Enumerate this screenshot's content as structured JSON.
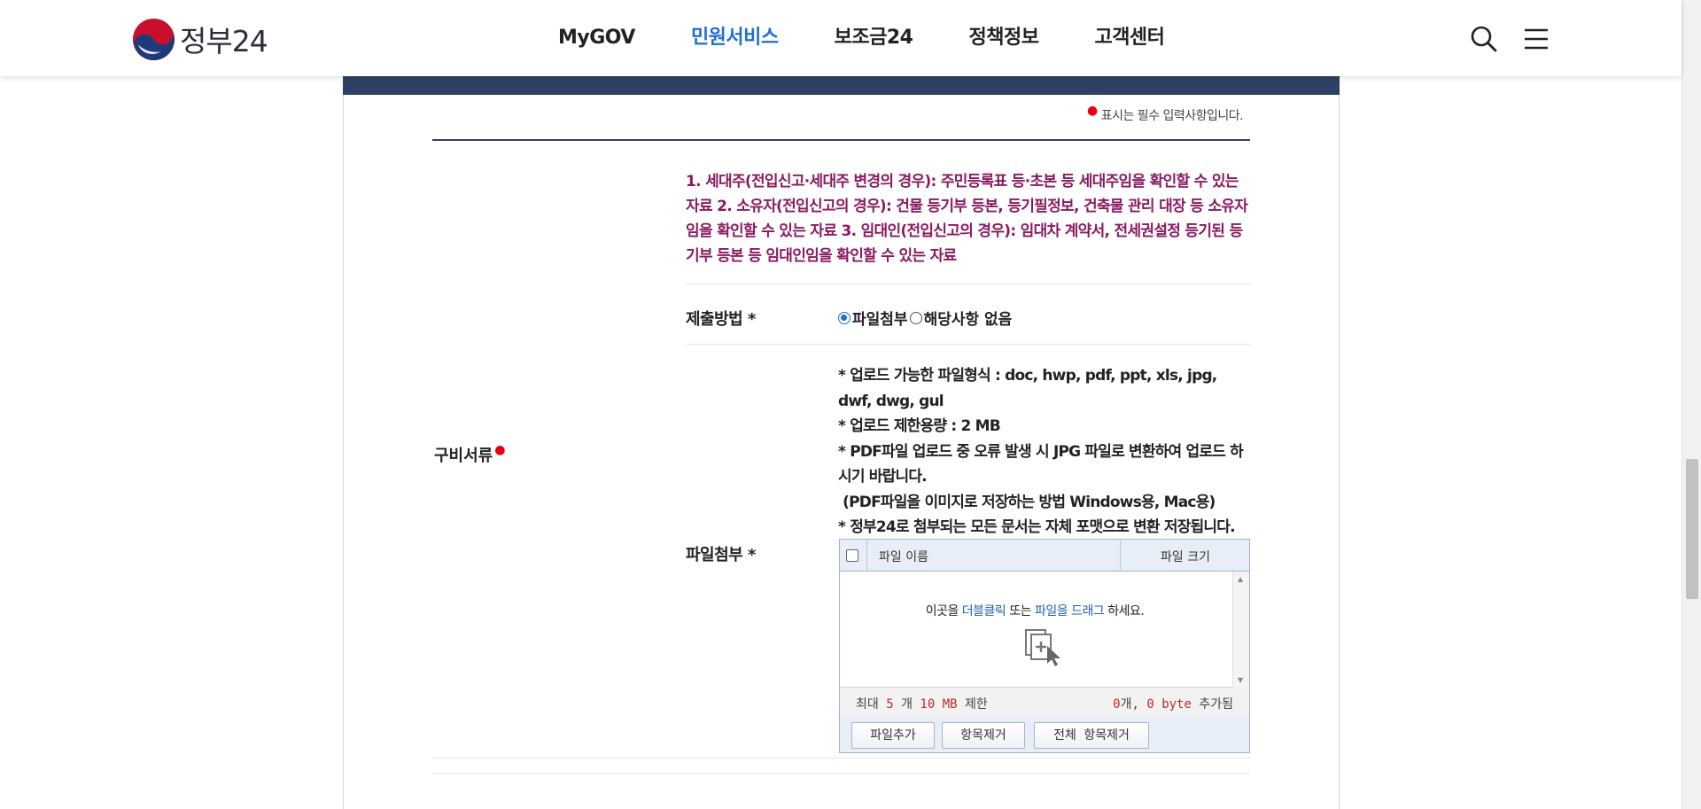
{
  "header": {
    "logo_text": "정부24",
    "nav": [
      "MyGOV",
      "민원서비스",
      "보조금24",
      "정책정보",
      "고객센터"
    ],
    "active_nav_index": 1,
    "active_color": "#1f6fd4"
  },
  "form": {
    "required_note": "표시는 필수 입력사항입니다.",
    "section_label": "구비서류",
    "notice": "1. 세대주(전입신고·세대주 변경의 경우): 주민등록표 등·초본 등 세대주임을 확인할 수 있는 자료 2. 소유자(전입신고의 경우): 건물 등기부 등본, 등기필정보, 건축물 관리 대장 등 소유자임을 확인할 수 있는 자료 3. 임대인(전입신고의 경우): 임대차 계약서, 전세권설정 등기된 등기부 등본 등 임대인임을 확인할 수 있는 자료",
    "submit_method_label": "제출방법 *",
    "submit_options": [
      "파일첨부",
      "해당사항 없음"
    ],
    "submit_selected_index": 0,
    "file_label": "파일첨부 *",
    "guide_lines": [
      "* 업로드 가능한 파일형식 : doc, hwp, pdf, ppt, xls, jpg, dwf, dwg, gul",
      "* 업로드 제한용량 : 2 MB",
      "* PDF파일 업로드 중 오류 발생 시 JPG 파일로 변환하여 업로드 하시기 바랍니다.",
      " (PDF파일을 이미지로 저장하는 방법 Windows용, Mac용)",
      "* 정부24로 첨부되는 모든 문서는 자체 포맷으로 변환 저장됩니다."
    ]
  },
  "uploader": {
    "col_name": "파일 이름",
    "col_size": "파일 크기",
    "hint_prefix": "이곳을",
    "hint_link1": "더블클릭",
    "hint_mid": "또는",
    "hint_link2": "파일을 드래그",
    "hint_suffix": "하세요.",
    "limit_prefix": "최대",
    "limit_count": "5",
    "limit_unit": "개",
    "limit_size": "10 MB",
    "limit_suffix": "제한",
    "added_count": "0",
    "added_count_unit": "개,",
    "added_size": "0",
    "added_size_unit": "byte",
    "added_suffix": "추가됨",
    "btn_add": "파일추가",
    "btn_remove": "항목제거",
    "btn_remove_all": "전체 항목제거"
  }
}
